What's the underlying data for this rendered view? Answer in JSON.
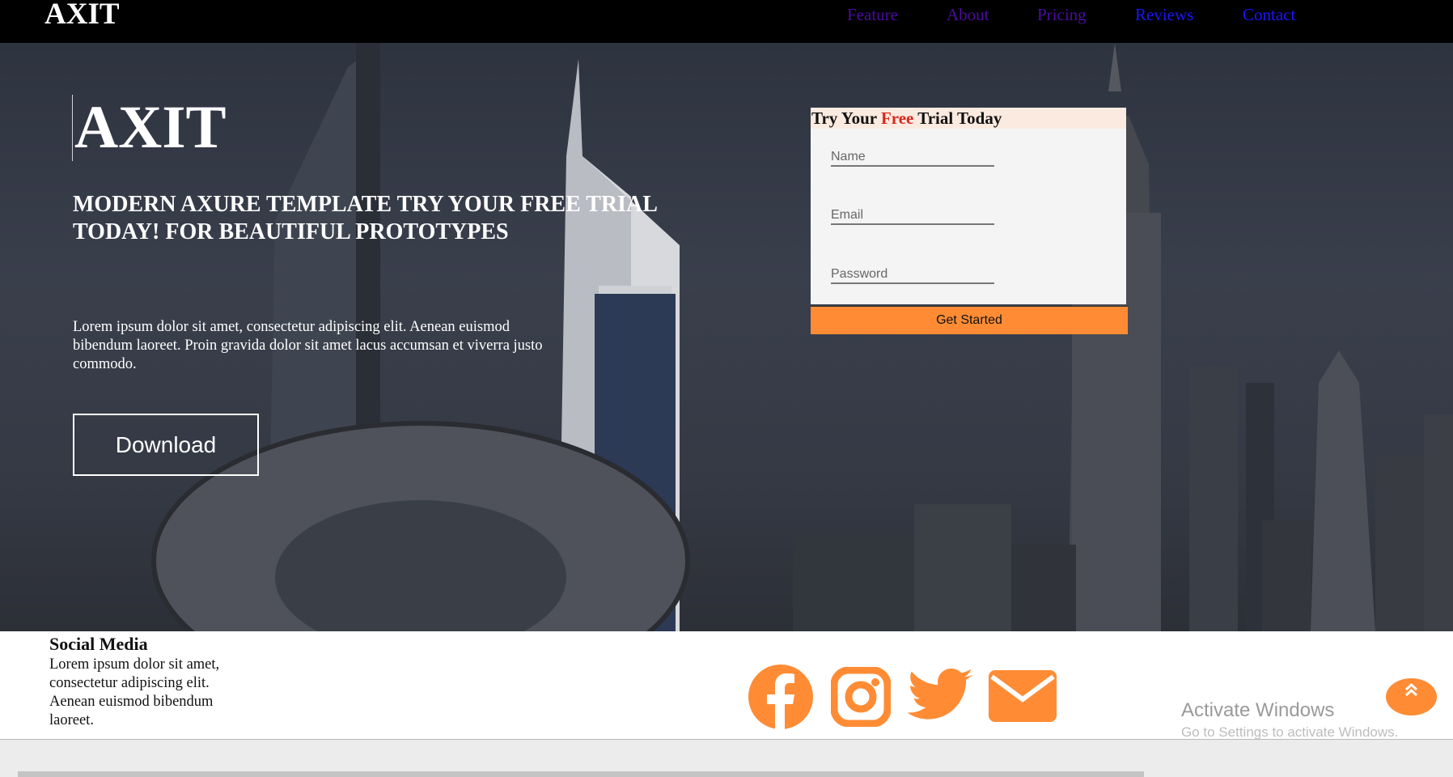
{
  "colors": {
    "accent": "#ff8c35",
    "free": "#d9281f",
    "nav_visited": "#4b0c9c",
    "nav_link": "#1a14ff"
  },
  "header": {
    "logo": "AXIT",
    "nav": [
      {
        "label": "Feature"
      },
      {
        "label": "About"
      },
      {
        "label": "Pricing"
      },
      {
        "label": "Reviews"
      },
      {
        "label": "Contact"
      }
    ]
  },
  "hero": {
    "title": "AXIT",
    "subtitle": "MODERN AXURE TEMPLATE TRY YOUR FREE TRIAL TODAY! FOR BEAUTIFUL PROTOTYPES",
    "body": "Lorem ipsum dolor sit amet, consectetur adipiscing elit. Aenean euismod bibendum laoreet. Proin gravida dolor sit amet lacus accumsan et viverra justo commodo.",
    "download_label": "Download"
  },
  "trial_form": {
    "title_before": "Try Your ",
    "title_free": "Free",
    "title_after": " Trial Today",
    "name_placeholder": "Name",
    "email_placeholder": "Email",
    "password_placeholder": "Password",
    "submit_label": "Get Started"
  },
  "footer": {
    "social_title": "Social Media",
    "social_text": "Lorem ipsum dolor sit amet, consectetur adipiscing elit. Aenean euismod bibendum laoreet.",
    "icons": [
      "facebook-icon",
      "instagram-icon",
      "twitter-icon",
      "mail-icon"
    ]
  },
  "os_watermark": {
    "line1": "Activate Windows",
    "line2": "Go to Settings to activate Windows."
  }
}
